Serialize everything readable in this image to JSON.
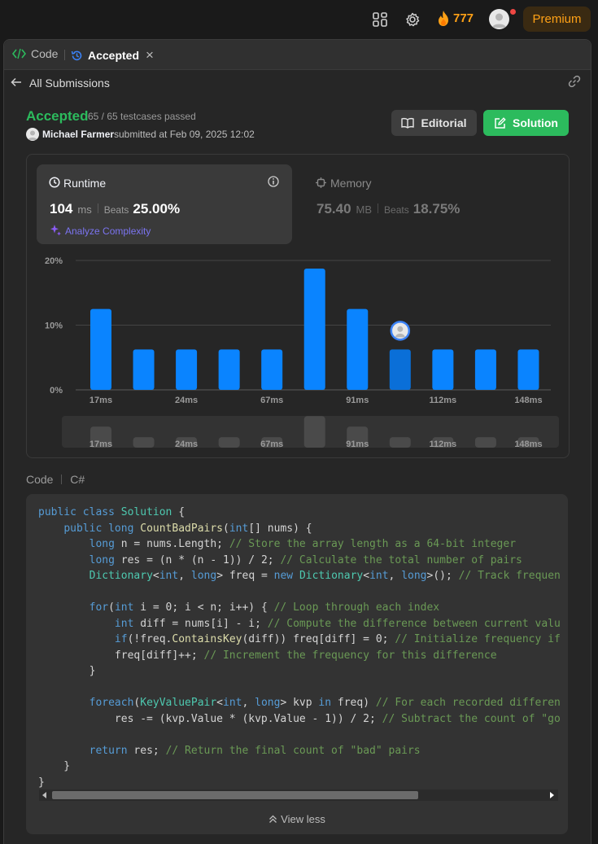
{
  "topbar": {
    "streak": "777",
    "premium_label": "Premium"
  },
  "tabs": {
    "code_label": "Code",
    "accepted_label": "Accepted",
    "close_glyph": "×"
  },
  "subnav": {
    "back_label": "All Submissions"
  },
  "submission": {
    "status": "Accepted",
    "testcases": "65 / 65 testcases passed",
    "user": "Michael Farmer",
    "submitted_text": "submitted at Feb 09, 2025 12:02",
    "editorial_label": "Editorial",
    "solution_label": "Solution"
  },
  "runtime": {
    "label": "Runtime",
    "value": "104",
    "unit": "ms",
    "beats_label": "Beats",
    "beats_value": "25.00%",
    "analyze_label": "Analyze Complexity"
  },
  "memory": {
    "label": "Memory",
    "value": "75.40",
    "unit": "MB",
    "beats_label": "Beats",
    "beats_value": "18.75%"
  },
  "chart_data": {
    "type": "bar",
    "y_ticks": [
      "20%",
      "10%",
      "0%"
    ],
    "ylim": [
      0,
      20
    ],
    "x_tick_labels": [
      "17ms",
      "24ms",
      "67ms",
      "91ms",
      "112ms",
      "148ms"
    ],
    "values": [
      12.5,
      6.25,
      6.25,
      6.25,
      6.25,
      18.75,
      12.5,
      6.25,
      6.25,
      6.25,
      6.25
    ],
    "highlight_index": 7,
    "grid": true
  },
  "code_section": {
    "label": "Code",
    "language": "C#",
    "view_less_label": "View less"
  },
  "colors": {
    "accepted": "#2cbb5d",
    "bar": "#0a84ff",
    "streak": "#ffa116"
  }
}
